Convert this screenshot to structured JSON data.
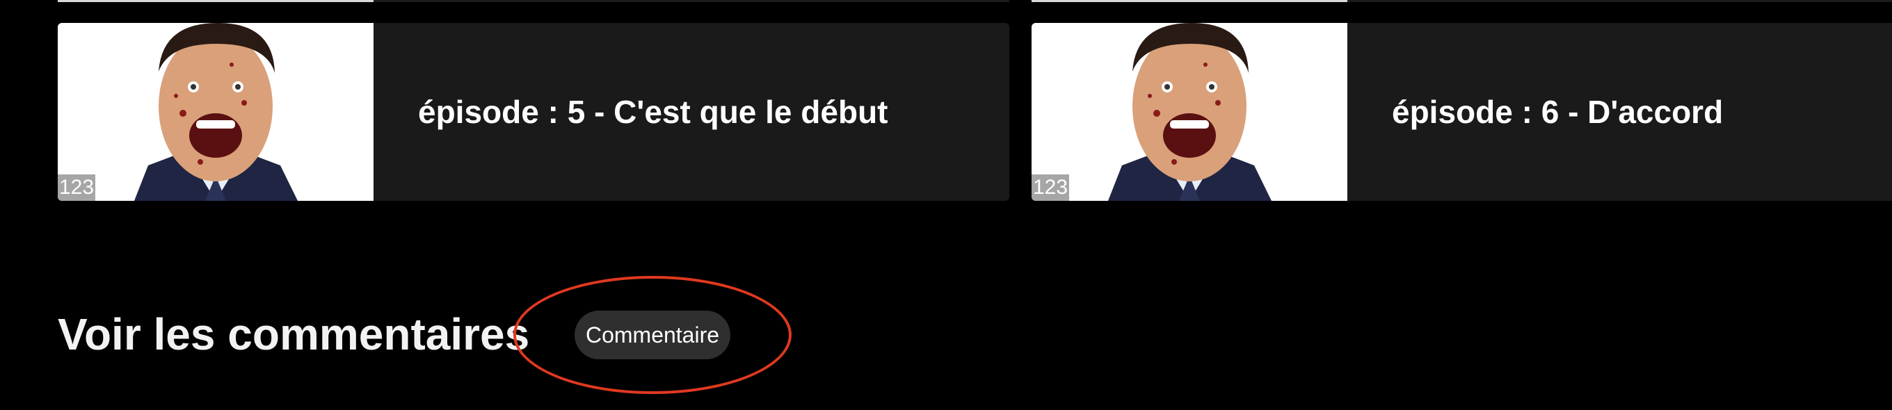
{
  "episodes": [
    {
      "title": "épisode : 5 - C'est que le début",
      "thumb_badge": "123"
    },
    {
      "title": "épisode : 6 - D'accord",
      "thumb_badge": "123"
    }
  ],
  "comments": {
    "heading": "Voir les commentaires",
    "button_label": "Commentaire"
  },
  "colors": {
    "background": "#000000",
    "card": "#1a1a1a",
    "button": "#2f2f2f",
    "annotation": "#e0391f"
  }
}
